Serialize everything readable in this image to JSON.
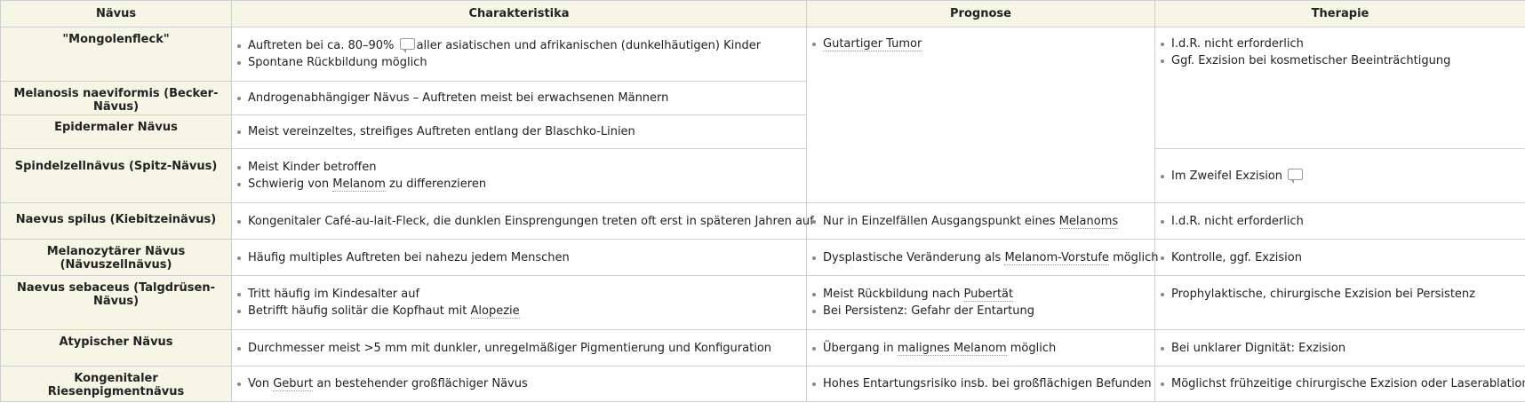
{
  "headers": [
    "Nävus",
    "Charakteristika",
    "Prognose",
    "Therapie"
  ],
  "rows": [
    {
      "name": "\"Mongolenfleck\"",
      "c1a": "Auftreten bei ca. 80–90%",
      "c1b": "aller asiatischen und afrikanischen (dunkelhäutigen) Kinder",
      "c2": "Spontane Rückbildung möglich"
    },
    {
      "name": "Melanosis naeviformis (Becker-Nävus)",
      "c1": "Androgenabhängiger Nävus – Auftreten meist bei erwachsenen Männern"
    },
    {
      "name": "Epidermaler Nävus",
      "c1": "Meist vereinzeltes, streifiges Auftreten entlang der Blaschko-Linien"
    },
    {
      "name": "Spindelzellnävus (Spitz-Nävus)",
      "c1": "Meist Kinder betroffen",
      "c2a": "Schwierig von",
      "c2link": "Melanom",
      "c2b": "zu differenzieren",
      "t1": "Im Zweifel Exzision"
    },
    {
      "name": "Naevus spilus (Kiebitzeinävus)",
      "c1": "Kongenitaler Café-au-lait-Fleck, die dunklen Einsprengungen treten oft erst in späteren Jahren auf",
      "p1a": "Nur in Einzelfällen Ausgangspunkt eines",
      "p1link": "Melanoms",
      "t1": "I.d.R. nicht erforderlich"
    },
    {
      "name": "Melanozytärer Nävus (Nävuszellnävus)",
      "c1": "Häufig multiples Auftreten bei nahezu jedem Menschen",
      "p1a": "Dysplastische Veränderung als",
      "p1link": "Melanom-Vorstufe",
      "p1b": "möglich",
      "t1": "Kontrolle, ggf. Exzision"
    },
    {
      "name": "Naevus sebaceus (Talgdrüsen-Nävus)",
      "c1": "Tritt häufig im Kindesalter auf",
      "c2a": "Betrifft häufig solitär die Kopfhaut mit",
      "c2link": "Alopezie",
      "p1a": "Meist Rückbildung nach",
      "p1link": "Pubertät",
      "p2": "Bei Persistenz: Gefahr der Entartung",
      "t1": "Prophylaktische, chirurgische Exzision bei Persistenz"
    },
    {
      "name": "Atypischer Nävus",
      "c1": "Durchmesser meist >5 mm mit dunkler, unregelmäßiger Pigmentierung und Konfiguration",
      "p1a": "Übergang in",
      "p1link": "malignes Melanom",
      "p1b": "möglich",
      "t1": "Bei unklarer Dignität: Exzision"
    },
    {
      "name": "Kongenitaler Riesenpigmentnävus",
      "c1a": "Von",
      "c1link": "Geburt",
      "c1b": "an bestehender großflächiger Nävus",
      "p1": "Hohes Entartungsrisiko insb. bei großflächigen Befunden",
      "t1": "Möglichst frühzeitige chirurgische Exzision oder Laserablation"
    }
  ],
  "shared": {
    "prognose_top_link": "Gutartiger Tumor",
    "therapie_top_1": "I.d.R. nicht erforderlich",
    "therapie_top_2": "Ggf. Exzision bei kosmetischer Beeinträchtigung"
  },
  "icons": {
    "comment": "comment-icon"
  }
}
